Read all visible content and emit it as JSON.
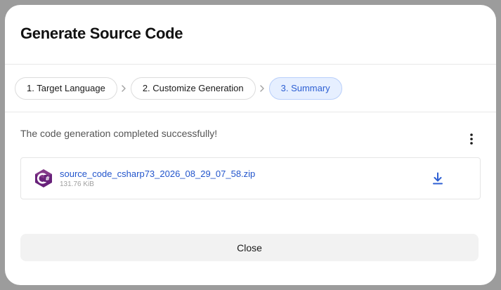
{
  "dialog": {
    "title": "Generate Source Code"
  },
  "steps": [
    {
      "label": "1. Target Language",
      "active": false
    },
    {
      "label": "2. Customize Generation",
      "active": false
    },
    {
      "label": "3. Summary",
      "active": true
    }
  ],
  "summary": {
    "status": "The code generation completed successfully!"
  },
  "file": {
    "name": "source_code_csharp73_2026_08_29_07_58.zip",
    "size": "131.76 KiB",
    "icon": "csharp-icon"
  },
  "footer": {
    "close_label": "Close"
  },
  "colors": {
    "accent": "#2d5fd3",
    "link": "#2255cc",
    "csharp_purple": "#68217a"
  }
}
